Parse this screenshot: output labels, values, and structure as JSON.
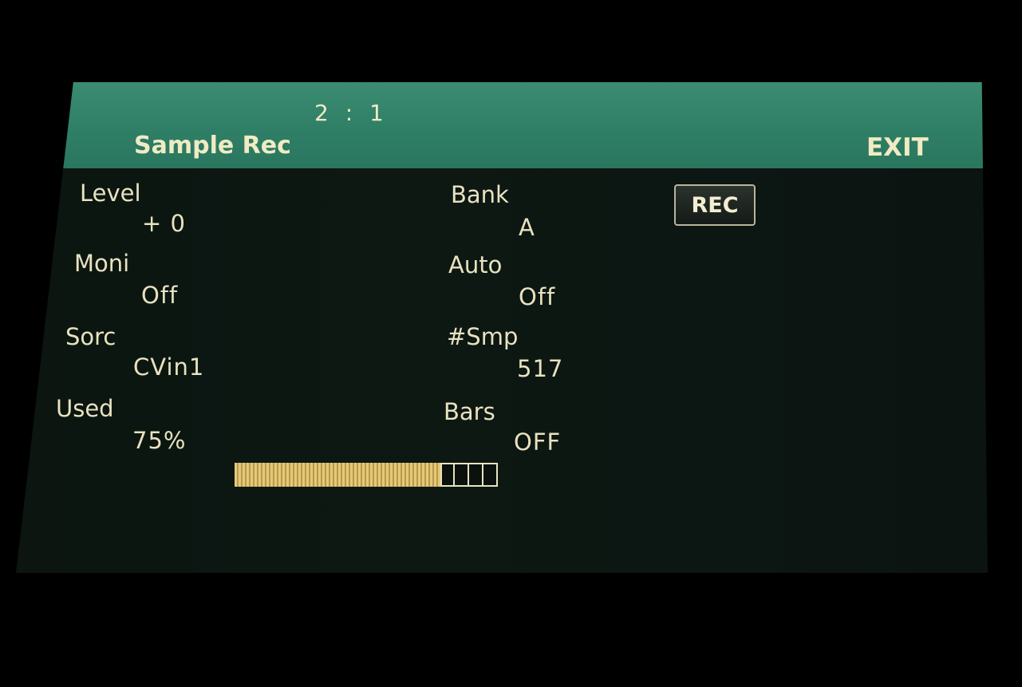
{
  "header": {
    "position": "2 : 1",
    "title": "Sample Rec",
    "exit_label": "EXIT"
  },
  "params": {
    "level": {
      "label": "Level",
      "value": "+ 0"
    },
    "moni": {
      "label": "Moni",
      "value": "Off"
    },
    "sorc": {
      "label": "Sorc",
      "value": "CVin1"
    },
    "used": {
      "label": "Used",
      "value": "75%"
    },
    "bank": {
      "label": "Bank",
      "value": "A"
    },
    "auto": {
      "label": "Auto",
      "value": "Off"
    },
    "num_smp": {
      "label": "#Smp",
      "value": "517"
    },
    "bars": {
      "label": "Bars",
      "value": "OFF"
    }
  },
  "rec_button": {
    "label": "REC"
  },
  "used_meter": {
    "fraction": 0.75,
    "total_segments": 16
  },
  "colors": {
    "header": "#2f7f66",
    "text": "#e8e2c0",
    "meter_fill": "#e6c978",
    "background": "#0c1510"
  }
}
